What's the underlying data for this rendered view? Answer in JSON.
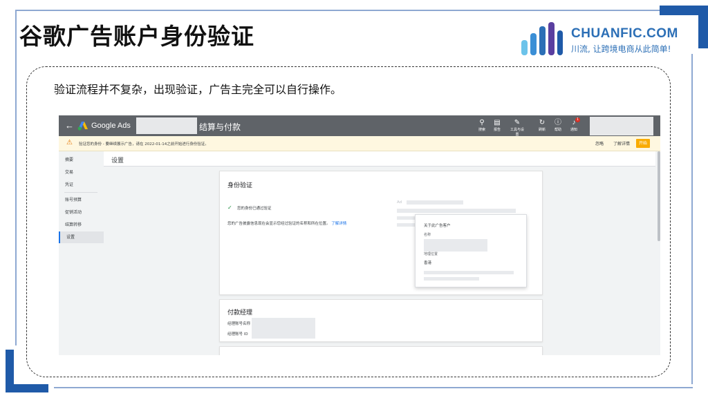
{
  "slide": {
    "title": "谷歌广告账户身份验证",
    "intro": "验证流程并不复杂，出现验证，广告主完全可以自行操作。",
    "brand_name": "CHUANFIC.COM",
    "brand_slogan": "川流, 让跨境电商从此简单!"
  },
  "ads": {
    "back_icon": "←",
    "app_name": "Google Ads",
    "section_title": "结算与付款",
    "toolbar": [
      {
        "icon": "search-icon",
        "glyph": "🔍",
        "label": "搜索"
      },
      {
        "icon": "report-icon",
        "glyph": "▤",
        "label": "报告"
      },
      {
        "icon": "wrench-icon",
        "glyph": "🔧",
        "label": "工具与设置"
      },
      {
        "icon": "refresh-icon",
        "glyph": "↻",
        "label": "刷新"
      },
      {
        "icon": "help-icon",
        "glyph": "?",
        "label": "帮助"
      },
      {
        "icon": "bell-icon",
        "glyph": "🔔",
        "label": "通知"
      }
    ],
    "notification_count": "1",
    "alert": {
      "text": "验证您的身份 - 要继续展示广告，请在 2022-01-14之前开始进行身份验证。",
      "dismiss": "忽略",
      "learn_more": "了解详情",
      "start": "开始"
    },
    "nav": [
      "摘要",
      "交易",
      "凭证",
      "账号预算",
      "促销活动",
      "结算转移",
      "设置"
    ],
    "nav_active": "设置",
    "page_title": "设置",
    "identity_card": {
      "title": "身份验证",
      "status": "您的身份已通过验证",
      "desc": "您的广告披露信息现在会显示您经过验证的名称和所在位置。",
      "learn_more": "了解详情",
      "ad_label": "Ad"
    },
    "popup": {
      "heading": "关于此广告客户",
      "name_label": "名称",
      "location_label": "地理位置",
      "location_value": "香港"
    },
    "payment_card": {
      "title": "付款经理",
      "manager_name_label": "经理账号名称",
      "manager_id_label": "经理账号 ID"
    }
  },
  "colors": {
    "accent_blue": "#1f5aa8",
    "brand_blue": "#2c6fb6",
    "ads_header": "#5f6368",
    "alert_bg": "#fef7e0",
    "start_button": "#f9ab00"
  }
}
